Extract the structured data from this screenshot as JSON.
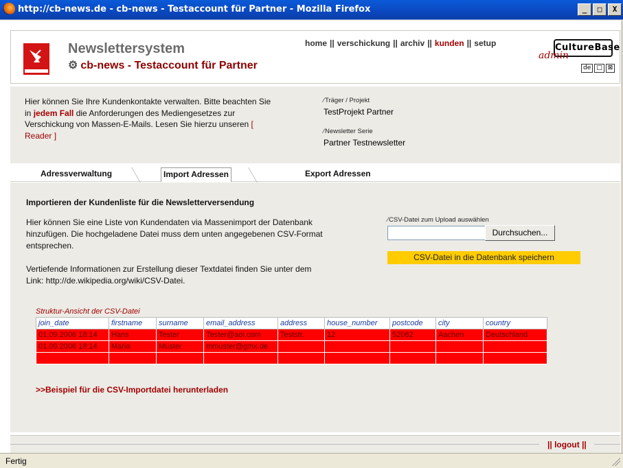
{
  "window": {
    "title": "http://cb-news.de - cb-news - Testaccount für Partner - Mozilla Firefox",
    "controls": {
      "minimize": "_",
      "maximize": "□",
      "close": "X"
    }
  },
  "header": {
    "app_name": "Newslettersystem",
    "account": "cb-news - Testaccount für Partner",
    "nav": [
      "home",
      "verschickung",
      "archiv",
      "kunden",
      "setup"
    ],
    "nav_separator": "||",
    "active_nav": "kunden",
    "brand": "CultureBase",
    "brand_sub": "admin",
    "languages": [
      "de",
      "□",
      "⊠"
    ]
  },
  "info": {
    "intro_before": "Hier können Sie Ihre Kundenkontakte verwalten. Bitte beachten Sie in ",
    "intro_highlight": "jedem Fall",
    "intro_after": " die Anforderungen des Mediengesetzes zur Verschickung von Massen-E-Mails. Lesen Sie hierzu unseren ",
    "reader_link": "[ Reader ]",
    "project_label": "Träger / Projekt",
    "project_value": "TestProjekt Partner",
    "series_label": "Newsletter Serie",
    "series_value": "Partner Testnewsletter"
  },
  "tabs": [
    {
      "label": "Adressverwaltung"
    },
    {
      "label": "Import Adressen",
      "active": true
    },
    {
      "label": "Export Adressen"
    }
  ],
  "import": {
    "heading": "Importieren der Kundenliste für die Newsletterversendung",
    "desc1": "Hier können Sie eine Liste von Kundendaten via Massenimport der Datenbank hinzufügen. Die hochgeladene Datei muss dem unten angegebenen CSV-Format entsprechen.",
    "desc2": "Vertiefende Informationen zur Erstellung dieser Textdatei finden Sie unter dem Link: http://de.wikipedia.org/wiki/CSV-Datei.",
    "upload_label": "CSV-Datei zum Upload auswählen",
    "upload_value": "",
    "browse_button": "Durchsuchen...",
    "save_button": "CSV-Datei in die Datenbank speichern",
    "table_title": "Struktur-Ansicht der CSV-Datei",
    "columns": [
      "join_date",
      "firstname",
      "surname",
      "email_address",
      "address",
      "house_number",
      "postcode",
      "city",
      "country"
    ],
    "rows": [
      [
        "01.09.2006 18:14",
        "Hans",
        "Tester",
        "Tester@aol.com",
        "Teststr.",
        "12",
        "52062",
        "Aachen",
        "Deutschland"
      ],
      [
        "01.09.2006 18:14",
        "Maria",
        "Muster",
        "mmuster@gmx.de",
        "",
        "",
        "",
        "",
        ""
      ],
      [
        "",
        "",
        "",
        "",
        "",
        "",
        "",
        "",
        ""
      ]
    ],
    "download_link": ">>Beispiel für die CSV-Importdatei herunterladen"
  },
  "footer": {
    "logout": "logout",
    "logout_prefix": "||",
    "logout_suffix": "||"
  },
  "statusbar": {
    "text": "Fertig"
  }
}
